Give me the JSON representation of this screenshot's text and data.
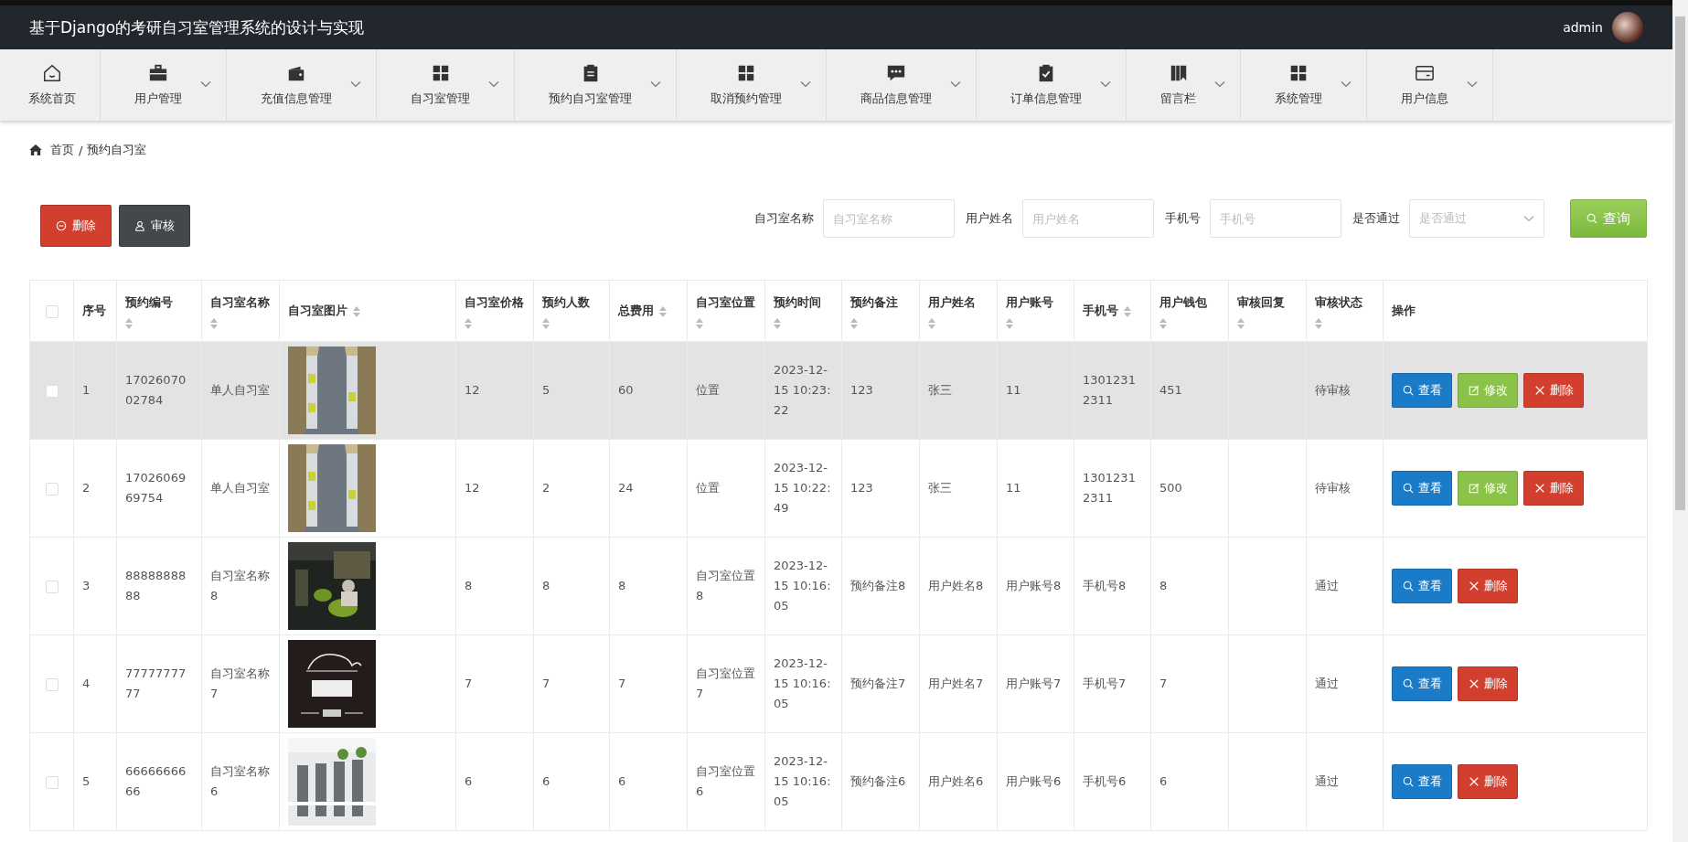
{
  "header": {
    "title": "基于Django的考研自习室管理系统的设计与实现",
    "user": "admin"
  },
  "nav": [
    {
      "label": "系统首页",
      "has_menu": false
    },
    {
      "label": "用户管理",
      "has_menu": true
    },
    {
      "label": "充值信息管理",
      "has_menu": true
    },
    {
      "label": "自习室管理",
      "has_menu": true
    },
    {
      "label": "预约自习室管理",
      "has_menu": true
    },
    {
      "label": "取消预约管理",
      "has_menu": true
    },
    {
      "label": "商品信息管理",
      "has_menu": true
    },
    {
      "label": "订单信息管理",
      "has_menu": true
    },
    {
      "label": "留言栏",
      "has_menu": true
    },
    {
      "label": "系统管理",
      "has_menu": true
    },
    {
      "label": "用户信息",
      "has_menu": true
    }
  ],
  "breadcrumb": [
    "首页",
    "/",
    "预约自习室"
  ],
  "toolbar": [
    {
      "label": "删除",
      "kind": "delete"
    },
    {
      "label": "审核",
      "kind": "audit"
    }
  ],
  "search": {
    "fields": [
      {
        "label": "自习室名称",
        "placeholder": "自习室名称",
        "kind": "input"
      },
      {
        "label": "用户姓名",
        "placeholder": "用户姓名",
        "kind": "input"
      },
      {
        "label": "手机号",
        "placeholder": "手机号",
        "kind": "input"
      },
      {
        "label": "是否通过",
        "placeholder": "是否通过",
        "kind": "select"
      }
    ],
    "button": "查询"
  },
  "table": {
    "select_all": {
      "checked": false
    },
    "columns": [
      {
        "label": "序号",
        "sortable": false
      },
      {
        "label": "预约编号",
        "sortable": true
      },
      {
        "label": "自习室名称",
        "sortable": true
      },
      {
        "label": "自习室图片",
        "sortable": true
      },
      {
        "label": "自习室价格",
        "sortable": true
      },
      {
        "label": "预约人数",
        "sortable": true
      },
      {
        "label": "总费用",
        "sortable": true
      },
      {
        "label": "自习室位置",
        "sortable": true
      },
      {
        "label": "预约时间",
        "sortable": true
      },
      {
        "label": "预约备注",
        "sortable": true
      },
      {
        "label": "用户姓名",
        "sortable": true
      },
      {
        "label": "用户账号",
        "sortable": true
      },
      {
        "label": "手机号",
        "sortable": true
      },
      {
        "label": "用户钱包",
        "sortable": true
      },
      {
        "label": "审核回复",
        "sortable": true
      },
      {
        "label": "审核状态",
        "sortable": true
      },
      {
        "label": "操作",
        "sortable": false
      }
    ],
    "rows": [
      {
        "checked": false,
        "highlighted": true,
        "cells": [
          "1",
          "1702607002784",
          "单人自习室",
          null,
          "12",
          "5",
          "60",
          "位置",
          "2023-12-15 10:23:22",
          "123",
          "张三",
          "11",
          "13012312311",
          "451",
          "",
          "待审核"
        ],
        "actions": [
          {
            "label": "查看",
            "kind": "view"
          },
          {
            "label": "修改",
            "kind": "edit"
          },
          {
            "label": "删除",
            "kind": "delete"
          }
        ]
      },
      {
        "checked": false,
        "highlighted": false,
        "cells": [
          "2",
          "1702606969754",
          "单人自习室",
          null,
          "12",
          "2",
          "24",
          "位置",
          "2023-12-15 10:22:49",
          "123",
          "张三",
          "11",
          "13012312311",
          "500",
          "",
          "待审核"
        ],
        "actions": [
          {
            "label": "查看",
            "kind": "view"
          },
          {
            "label": "修改",
            "kind": "edit"
          },
          {
            "label": "删除",
            "kind": "delete"
          }
        ]
      },
      {
        "checked": false,
        "highlighted": false,
        "cells": [
          "3",
          "8888888888",
          "自习室名称8",
          null,
          "8",
          "8",
          "8",
          "自习室位置8",
          "2023-12-15 10:16:05",
          "预约备注8",
          "用户姓名8",
          "用户账号8",
          "手机号8",
          "8",
          "",
          "通过"
        ],
        "actions": [
          {
            "label": "查看",
            "kind": "view"
          },
          {
            "label": "删除",
            "kind": "delete"
          }
        ]
      },
      {
        "checked": false,
        "highlighted": false,
        "cells": [
          "4",
          "7777777777",
          "自习室名称7",
          null,
          "7",
          "7",
          "7",
          "自习室位置7",
          "2023-12-15 10:16:05",
          "预约备注7",
          "用户姓名7",
          "用户账号7",
          "手机号7",
          "7",
          "",
          "通过"
        ],
        "actions": [
          {
            "label": "查看",
            "kind": "view"
          },
          {
            "label": "删除",
            "kind": "delete"
          }
        ]
      },
      {
        "checked": false,
        "highlighted": false,
        "cells": [
          "5",
          "6666666666",
          "自习室名称6",
          null,
          "6",
          "6",
          "6",
          "自习室位置6",
          "2023-12-15 10:16:05",
          "预约备注6",
          "用户姓名6",
          "用户账号6",
          "手机号6",
          "6",
          "",
          "通过"
        ],
        "actions": [
          {
            "label": "查看",
            "kind": "view"
          },
          {
            "label": "删除",
            "kind": "delete"
          }
        ]
      }
    ]
  }
}
